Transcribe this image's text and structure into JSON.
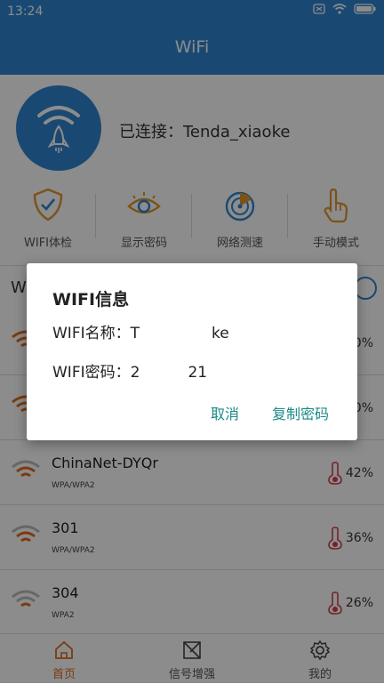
{
  "statusbar": {
    "time": "13:24"
  },
  "appbar": {
    "title": "WiFi"
  },
  "header": {
    "connected_text": "已连接：Tenda_xiaoke"
  },
  "tools": [
    {
      "label": "WIFI体检",
      "icon": "shield-check-icon"
    },
    {
      "label": "显示密码",
      "icon": "eye-icon"
    },
    {
      "label": "网络测速",
      "icon": "speed-radar-icon"
    },
    {
      "label": "手动模式",
      "icon": "hand-pointer-icon"
    }
  ],
  "toggle_row": {
    "label": "W"
  },
  "networks": [
    {
      "name": "",
      "security": "",
      "percent": "0%"
    },
    {
      "name": "",
      "security": "",
      "percent": "0%"
    },
    {
      "name": "ChinaNet-DYQr",
      "security": "WPA/WPA2",
      "percent": "42%"
    },
    {
      "name": "301",
      "security": "WPA/WPA2",
      "percent": "36%"
    },
    {
      "name": "304",
      "security": "WPA2",
      "percent": "26%"
    }
  ],
  "bottom_nav": [
    {
      "label": "首页",
      "icon": "home-icon"
    },
    {
      "label": "信号增强",
      "icon": "signal-boost-icon"
    },
    {
      "label": "我的",
      "icon": "settings-gear-icon"
    }
  ],
  "dialog": {
    "title": "WIFI信息",
    "name_line": "WIFI名称：T               ke",
    "password_line": "WIFI密码：2          21",
    "cancel_label": "取消",
    "copy_label": "复制密码"
  },
  "colors": {
    "primary": "#2f86d0",
    "accent": "#e06a1f",
    "dialog_button": "#1a8a86"
  }
}
